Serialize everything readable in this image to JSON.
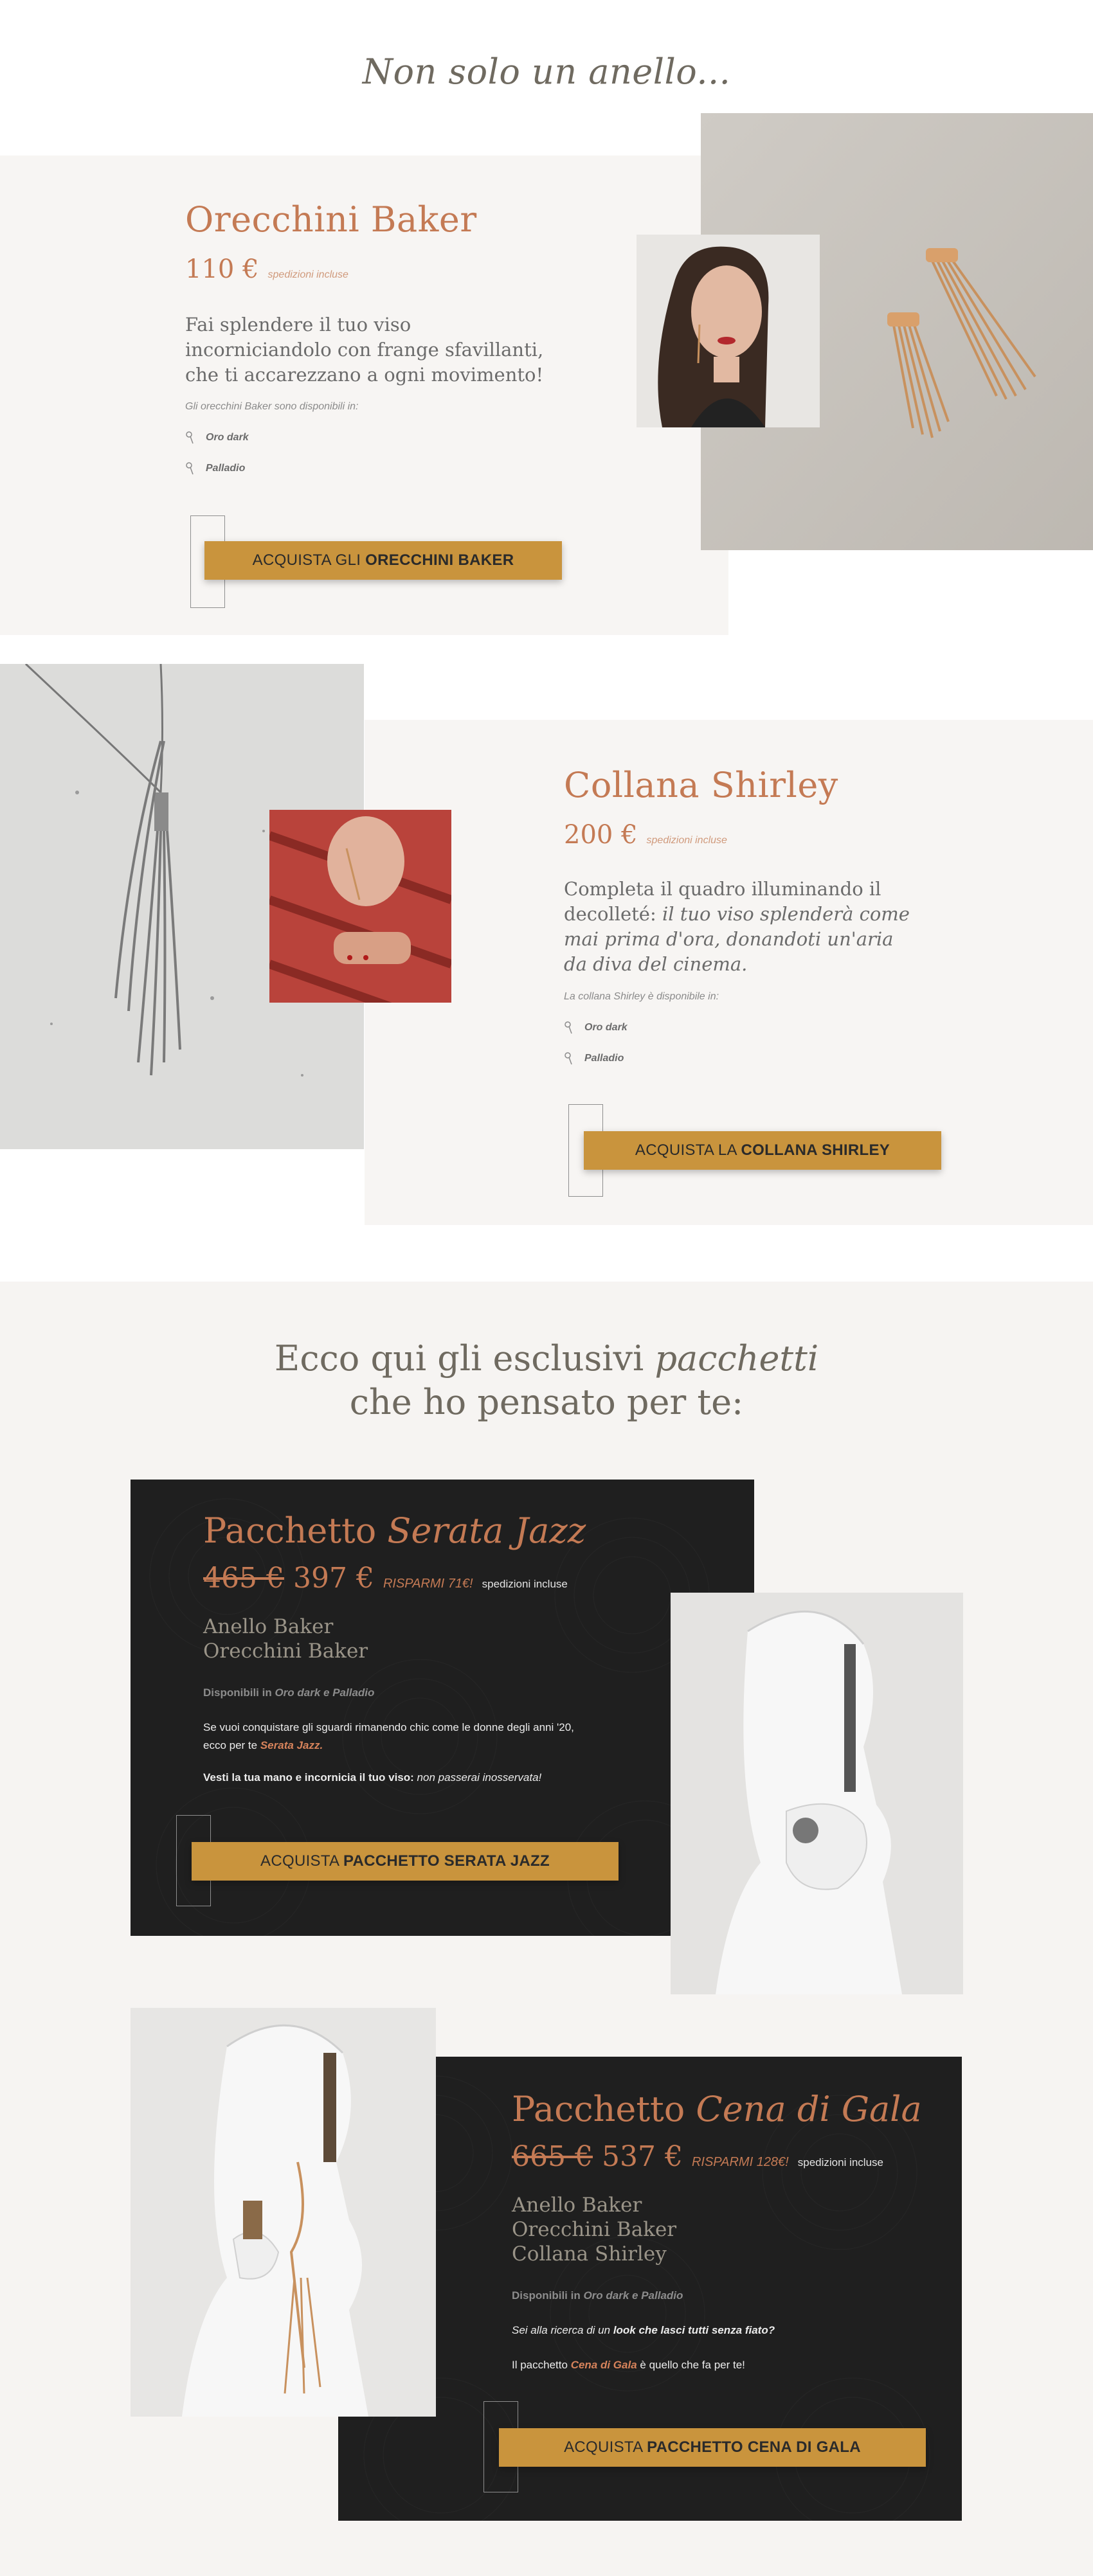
{
  "hero_title": "Non solo un anello...",
  "products": {
    "earrings": {
      "title": "Orecchini Baker",
      "price": "110 €",
      "shipping": "spedizioni incluse",
      "description": "Fai splendere il tuo viso incorniciandolo con frange sfavillanti, che ti accarezzano a ogni movimento!",
      "availability_label": "Gli orecchini Baker sono disponibili in:",
      "variants": [
        "Oro dark",
        "Palladio"
      ],
      "button_prefix": "ACQUISTA GLI",
      "button_bold": "ORECCHINI BAKER"
    },
    "necklace": {
      "title": "Collana Shirley",
      "price": "200 €",
      "shipping": "spedizioni incluse",
      "description_plain": "Completa il quadro illuminando il decolleté:",
      "description_italic": "il tuo viso splenderà come mai prima d'ora, donandoti un'aria da diva del cinema.",
      "availability_label": "La collana Shirley è disponibile in:",
      "variants": [
        "Oro dark",
        "Palladio"
      ],
      "button_prefix": "ACQUISTA LA",
      "button_bold": "COLLANA SHIRLEY"
    }
  },
  "packages_heading": {
    "line1_plain": "Ecco qui gli esclusivi",
    "line1_italic": "pacchetti",
    "line2": "che ho pensato per te:"
  },
  "packages": {
    "jazz": {
      "title_plain": "Pacchetto",
      "title_italic": "Serata Jazz",
      "old_price": "465 €",
      "new_price": "397 €",
      "savings": "RISPARMI 71€!",
      "shipping": "spedizioni incluse",
      "items": [
        "Anello Baker",
        "Orecchini Baker"
      ],
      "avail_prefix": "Disponibili in",
      "avail_italic": "Oro dark e Palladio",
      "text1": "Se vuoi conquistare gli sguardi rimanendo chic come le donne degli anni '20, ecco per te",
      "text1_accent": "Serata Jazz.",
      "text2_bold": "Vesti la tua mano e incornicia il tuo viso:",
      "text2_italic": "non passerai inosservata!",
      "button_prefix": "ACQUISTA",
      "button_bold": "PACCHETTO SERATA JAZZ"
    },
    "gala": {
      "title_plain": "Pacchetto",
      "title_italic": "Cena di Gala",
      "old_price": "665 €",
      "new_price": "537 €",
      "savings": "RISPARMI 128€!",
      "shipping": "spedizioni incluse",
      "items": [
        "Anello Baker",
        "Orecchini Baker",
        "Collana Shirley"
      ],
      "avail_prefix": "Disponibili in",
      "avail_italic": "Oro dark e Palladio",
      "text1_italic": "Sei alla ricerca di un",
      "text1_bold": "look che lasci tutti senza fiato?",
      "text2_prefix": "Il pacchetto",
      "text2_accent": "Cena di Gala",
      "text2_suffix": "è quello che fa per te!",
      "button_prefix": "ACQUISTA",
      "button_bold": "PACCHETTO CENA DI GALA"
    }
  },
  "icons": {
    "variant_icon": "ring-icon"
  },
  "colors": {
    "accent": "#c47a54",
    "button": "#c9943d",
    "panel": "#f7f5f3",
    "dark_card": "#1f1f1f"
  }
}
